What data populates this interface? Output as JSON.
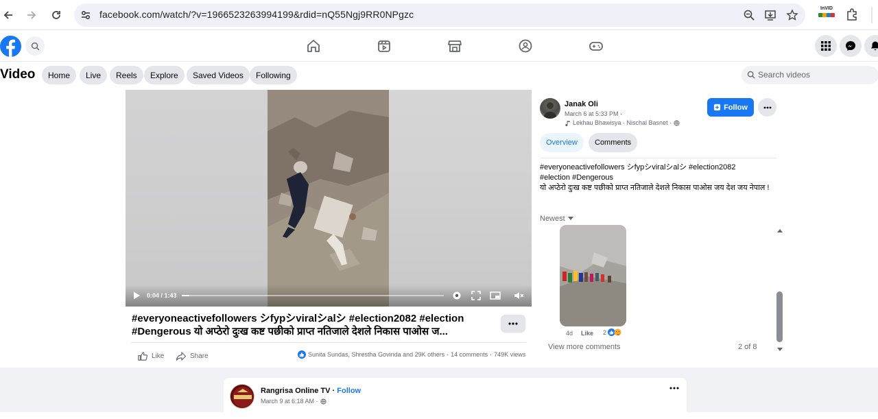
{
  "browser": {
    "url": "facebook.com/watch/?v=1966523263994199&rdid=nQ55Ngj9RR0NPgzc",
    "extension_label": "InVID"
  },
  "header": {
    "nav_icons": [
      "home-icon",
      "video-icon",
      "marketplace-icon",
      "groups-icon",
      "gaming-icon"
    ],
    "right_icons": [
      "apps-grid-icon",
      "messenger-icon",
      "notifications-icon"
    ]
  },
  "watch": {
    "title": "Video",
    "tabs": [
      "Home",
      "Live",
      "Reels",
      "Explore",
      "Saved Videos",
      "Following"
    ],
    "search_placeholder": "Search videos"
  },
  "player": {
    "time": "0:04 / 1:43",
    "progress": 0.03
  },
  "video": {
    "title": "#everyoneactivefollowers シfypシviralシalシ #election2082 #election #Dengerous यो अप्ठेरो दुःख कष्ट पछीको प्राप्त नतिजाले देशले निकास पाओस ज...",
    "like_label": "Like",
    "share_label": "Share",
    "reactors": "Sunita Sundas, Shrestha Govinda and 29K others",
    "comments": "14 comments",
    "views": "749K views"
  },
  "panel": {
    "author": "Janak Oli",
    "date": "March 6 at 5:33 PM ·",
    "music": "Lekhau Bhawisya · Nischal Basnet ·",
    "follow_label": "Follow",
    "tabs": [
      "Overview",
      "Comments"
    ],
    "description_line1": "#everyoneactivefollowers シfypシviralシalシ #election2082",
    "description_line2": "#election #Dengerous",
    "description_line3": "यो अप्ठेरो दुःख कष्ट पछीको प्राप्त नतिजाले देशले निकास पाओस जय देश जय नेपाल !",
    "sort_label": "Newest",
    "comment": {
      "age": "4d",
      "like_label": "Like",
      "reaction_count": "2"
    },
    "view_more": "View more comments",
    "count": "2 of 8"
  },
  "next_post": {
    "page_name": "Rangrisa Online TV",
    "follow_label": "Follow",
    "date": "March 9 at 6:18 AM ·"
  },
  "colors": {
    "brand_blue": "#1877f2",
    "pill_gray": "#e4e6eb",
    "text_secondary": "#65676b"
  }
}
